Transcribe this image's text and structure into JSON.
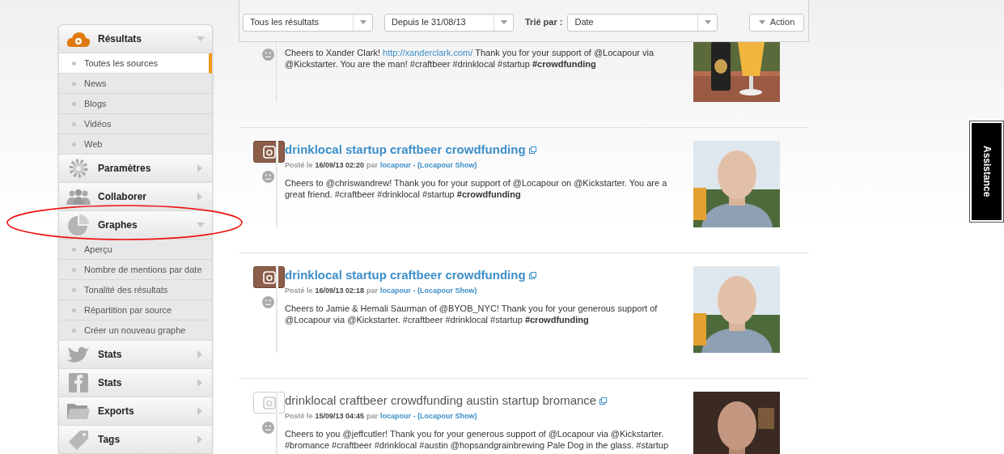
{
  "sidebar": {
    "sections": [
      {
        "label": "Résultats",
        "expanded": true,
        "items": [
          {
            "label": "Toutes les sources",
            "selected": true
          },
          {
            "label": "News",
            "selected": false
          },
          {
            "label": "Blogs",
            "selected": false
          },
          {
            "label": "Vidéos",
            "selected": false
          },
          {
            "label": "Web",
            "selected": false
          }
        ]
      },
      {
        "label": "Paramètres",
        "expanded": false
      },
      {
        "label": "Collaborer",
        "expanded": false
      },
      {
        "label": "Graphes",
        "expanded": true,
        "items": [
          {
            "label": "Aperçu",
            "selected": false
          },
          {
            "label": "Nombre de mentions par date",
            "selected": false
          },
          {
            "label": "Tonalité des résultats",
            "selected": false
          },
          {
            "label": "Répartition par source",
            "selected": false
          },
          {
            "label": "Créer un nouveau graphe",
            "selected": false
          }
        ]
      },
      {
        "label": "Stats",
        "expanded": false
      },
      {
        "label": "Stats",
        "expanded": false
      },
      {
        "label": "Exports",
        "expanded": false
      },
      {
        "label": "Tags",
        "expanded": false
      }
    ]
  },
  "toolbar": {
    "filter": "Tous les résultats",
    "period": "Depuis le 31/08/13",
    "sort_label": "Trié par :",
    "sort": "Date",
    "action": "Action"
  },
  "posts": [
    {
      "kind": "cut",
      "body": [
        {
          "kind": "text",
          "text": "Cheers to Xander Clark! "
        },
        {
          "kind": "link",
          "text": "http://xanderclark.com/"
        },
        {
          "kind": "text",
          "text": " Thank you for your support of @Locapour via @Kickstarter. You are the man! #craftbeer #drinklocal #startup **#crowdfunding**"
        }
      ]
    },
    {
      "kind": "full",
      "read": false,
      "title": "drinklocal startup craftbeer crowdfunding",
      "posted": "Posté le",
      "date": "16/09/13 02:20",
      "by": "par",
      "author": "locapour - (Locapour Show)",
      "body": [
        {
          "kind": "text",
          "text": "Cheers to @chriswandrew! Thank you for your support of @Locapour on @Kickstarter. You are a great friend. #craftbeer #drinklocal #startup **#crowdfunding**"
        }
      ]
    },
    {
      "kind": "full",
      "read": false,
      "title": "drinklocal startup craftbeer crowdfunding",
      "posted": "Posté le",
      "date": "16/09/13 02:18",
      "by": "par",
      "author": "locapour - (Locapour Show)",
      "body": [
        {
          "kind": "text",
          "text": "Cheers to Jamie & Hemali Saurman of @BYOB_NYC! Thank you for your generous support of @Locapour via @Kickstarter. #craftbeer #drinklocal #startup **#crowdfunding**"
        }
      ]
    },
    {
      "kind": "full",
      "read": true,
      "title": "drinklocal craftbeer crowdfunding austin startup bromance",
      "posted": "Posté le",
      "date": "15/09/13 04:45",
      "by": "par",
      "author": "locapour - (Locapour Show)",
      "body": [
        {
          "kind": "text",
          "text": "Cheers to you @jeffcutler! Thank you for your generous support of @Locapour via @Kickstarter. #bromance #craftbeer #drinklocal #austin @hopsandgrainbrewing Pale Dog in the glass. #startup"
        }
      ]
    }
  ],
  "assistance": "Assistance"
}
